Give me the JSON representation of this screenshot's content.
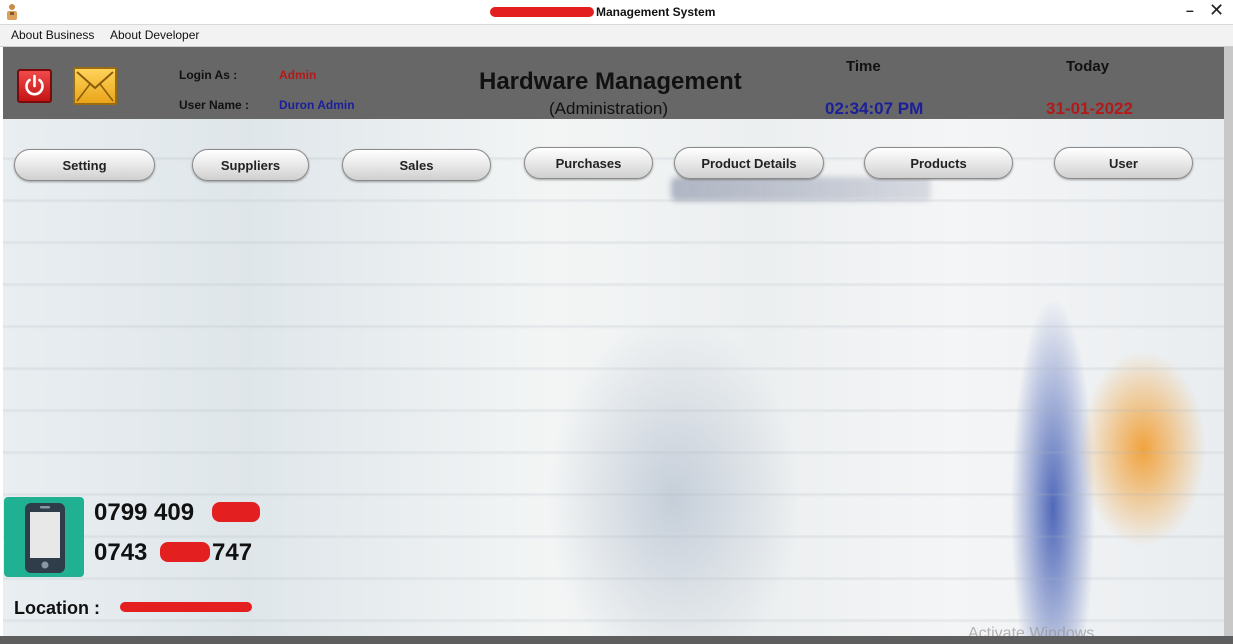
{
  "window": {
    "title": "Management System",
    "minimize_glyph": "–",
    "close_glyph": "✕"
  },
  "menu": {
    "items": [
      "About Business",
      "About Developer"
    ]
  },
  "header": {
    "login_as_label": "Login As :",
    "login_as_value": "Admin",
    "user_name_label": "User Name :",
    "user_name_value": "Duron Admin",
    "title": "Hardware Management",
    "subtitle": "(Administration)",
    "time_label": "Time",
    "time_value": "02:34:07 PM",
    "today_label": "Today",
    "today_value": "31-01-2022"
  },
  "nav": {
    "buttons": [
      "Setting",
      "Suppliers",
      "Sales",
      "Purchases",
      "Product Details",
      "Products",
      "User"
    ]
  },
  "contact": {
    "phone1": "0799 409",
    "phone2_prefix": "0743",
    "phone2_suffix": "747",
    "location_label": "Location :"
  },
  "watermark": "Activate Windows",
  "colors": {
    "header_bg": "#676767",
    "admin_red": "#b21a1a",
    "user_blue": "#1b1f9a",
    "phone_teal": "#20b092"
  },
  "icons": [
    "app-icon",
    "power-icon",
    "mail-icon",
    "mobile-phone-icon"
  ]
}
